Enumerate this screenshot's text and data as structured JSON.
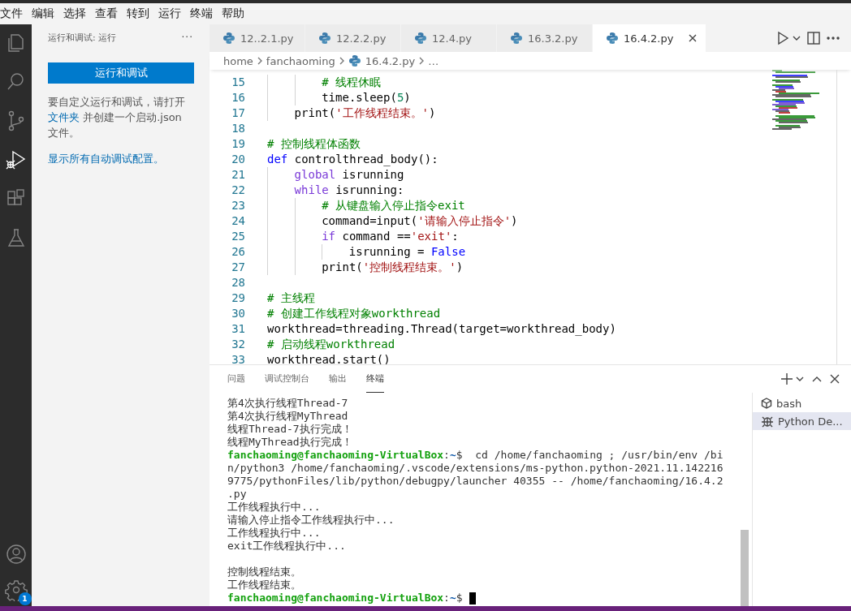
{
  "menu": [
    "文件",
    "编辑",
    "选择",
    "查看",
    "转到",
    "运行",
    "终端",
    "帮助"
  ],
  "activity_bar": [
    {
      "kind": "files",
      "selected": false
    },
    {
      "kind": "search",
      "selected": false
    },
    {
      "kind": "source-control",
      "selected": false
    },
    {
      "kind": "run",
      "selected": true
    },
    {
      "kind": "extensions",
      "selected": false
    },
    {
      "kind": "flask",
      "selected": false
    }
  ],
  "activity_bottom": {
    "settings_badge": "1"
  },
  "sidebar": {
    "title": "运行和调试: 运行",
    "more": "···",
    "run_button": "运行和调试",
    "text_before": "要自定义运行和调试，请打开 ",
    "link": "文件夹",
    "text_after": " 并创建一个启动.json 文件。",
    "show_link": "显示所有自动调试配置。"
  },
  "tabs": [
    {
      "label": "12..2.1.py",
      "selected": false
    },
    {
      "label": "12.2.2.py",
      "selected": false
    },
    {
      "label": "12.4.py",
      "selected": false
    },
    {
      "label": "16.3.2.py",
      "selected": false
    },
    {
      "label": "16.4.2.py",
      "selected": true
    }
  ],
  "breadcrumb": {
    "folders": [
      "home",
      "fanchaoming"
    ],
    "file": "16.4.2.py",
    "ellipsis": "…"
  },
  "code": [
    {
      "children": [
        {
          "children": [
            {
              "number": "15",
              "tokens": [
                {
                  "kind": "comment",
                  "text": "# 线程休眠"
                }
              ]
            },
            {
              "number": "16",
              "tokens": [
                {
                  "kind": "plain",
                  "text": "time.sleep("
                },
                {
                  "kind": "number",
                  "text": "5"
                },
                {
                  "kind": "plain",
                  "text": ")"
                }
              ]
            }
          ]
        },
        {
          "number": "17",
          "tokens": [
            {
              "kind": "plain",
              "text": "print("
            },
            {
              "kind": "string",
              "text": "'工作线程结束。'"
            },
            {
              "kind": "plain",
              "text": ")"
            }
          ]
        }
      ]
    },
    {
      "number": "18"
    },
    {
      "number": "19",
      "tokens": [
        {
          "kind": "comment",
          "text": "# 控制线程体函数"
        }
      ]
    },
    {
      "number": "20",
      "tokens": [
        {
          "kind": "keyword",
          "text": "def"
        },
        {
          "kind": "plain",
          "text": " controlthread_body():"
        }
      ],
      "children": [
        {
          "number": "21",
          "tokens": [
            {
              "kind": "control",
              "text": "global"
            },
            {
              "kind": "plain",
              "text": " isrunning"
            }
          ]
        },
        {
          "number": "22",
          "tokens": [
            {
              "kind": "control",
              "text": "while"
            },
            {
              "kind": "plain",
              "text": " isrunning:"
            }
          ],
          "children": [
            {
              "number": "23",
              "tokens": [
                {
                  "kind": "comment",
                  "text": "# 从键盘输入停止指令exit"
                }
              ]
            },
            {
              "number": "24",
              "tokens": [
                {
                  "kind": "plain",
                  "text": "command=input("
                },
                {
                  "kind": "string",
                  "text": "'请输入停止指令'"
                },
                {
                  "kind": "plain",
                  "text": ")"
                }
              ]
            },
            {
              "number": "25",
              "tokens": [
                {
                  "kind": "control",
                  "text": "if"
                },
                {
                  "kind": "plain",
                  "text": " command =="
                },
                {
                  "kind": "string",
                  "text": "'exit'"
                },
                {
                  "kind": "plain",
                  "text": ":"
                }
              ],
              "children": [
                {
                  "number": "26",
                  "tokens": [
                    {
                      "kind": "plain",
                      "text": "isrunning = "
                    },
                    {
                      "kind": "keyword",
                      "text": "False"
                    }
                  ]
                }
              ]
            },
            {
              "number": "27",
              "tokens": [
                {
                  "kind": "plain",
                  "text": "print("
                },
                {
                  "kind": "string",
                  "text": "'控制线程结束。'"
                },
                {
                  "kind": "plain",
                  "text": ")"
                }
              ]
            }
          ]
        }
      ]
    },
    {
      "number": "28"
    },
    {
      "number": "29",
      "tokens": [
        {
          "kind": "comment",
          "text": "# 主线程"
        }
      ]
    },
    {
      "number": "30",
      "tokens": [
        {
          "kind": "comment",
          "text": "# 创建工作线程对象workthread"
        }
      ]
    },
    {
      "number": "31",
      "tokens": [
        {
          "kind": "plain",
          "text": "workthread=threading.Thread(target=workthread_body)"
        }
      ]
    },
    {
      "number": "32",
      "tokens": [
        {
          "kind": "comment",
          "text": "# 启动线程workthread"
        }
      ]
    },
    {
      "number": "33",
      "tokens": [
        {
          "kind": "plain",
          "text": "workthread.start()"
        }
      ]
    }
  ],
  "panel_tabs": [
    {
      "label": "问题",
      "selected": false
    },
    {
      "label": "调试控制台",
      "selected": false
    },
    {
      "label": "输出",
      "selected": false
    },
    {
      "label": "终端",
      "selected": true
    }
  ],
  "terminal": [
    {
      "kind": "text",
      "text": "第4次执行线程Thread-7"
    },
    {
      "kind": "text",
      "text": "第4次执行线程MyThread"
    },
    {
      "kind": "text",
      "text": "线程Thread-7执行完成！"
    },
    {
      "kind": "text",
      "text": "线程MyThread执行完成！"
    },
    {
      "kind": "prompt",
      "user": "fanchaoming@fanchaoming-VirtualBox",
      "sep": ":",
      "path": "~",
      "text": "$  cd /home/fanchaoming ; /usr/bin/env /bi"
    },
    {
      "kind": "text",
      "text": "n/python3 /home/fanchaoming/.vscode/extensions/ms-python.python-2021.11.142216"
    },
    {
      "kind": "text",
      "text": "9775/pythonFiles/lib/python/debugpy/launcher 40355 -- /home/fanchaoming/16.4.2"
    },
    {
      "kind": "text",
      "text": ".py"
    },
    {
      "kind": "text",
      "text": "工作线程执行中..."
    },
    {
      "kind": "text",
      "text": "请输入停止指令工作线程执行中..."
    },
    {
      "kind": "text",
      "text": "工作线程执行中..."
    },
    {
      "kind": "text",
      "text": "exit工作线程执行中..."
    },
    {
      "kind": "blank"
    },
    {
      "kind": "text",
      "text": "控制线程结束。"
    },
    {
      "kind": "text",
      "text": "工作线程结束。"
    },
    {
      "kind": "prompt",
      "user": "fanchaoming@fanchaoming-VirtualBox",
      "sep": ":",
      "path": "~",
      "text": "$",
      "cursor": true
    }
  ],
  "terminals": [
    {
      "kind": "shell",
      "label": "bash",
      "selected": false
    },
    {
      "kind": "debug",
      "label": "Python De...",
      "selected": true
    }
  ]
}
